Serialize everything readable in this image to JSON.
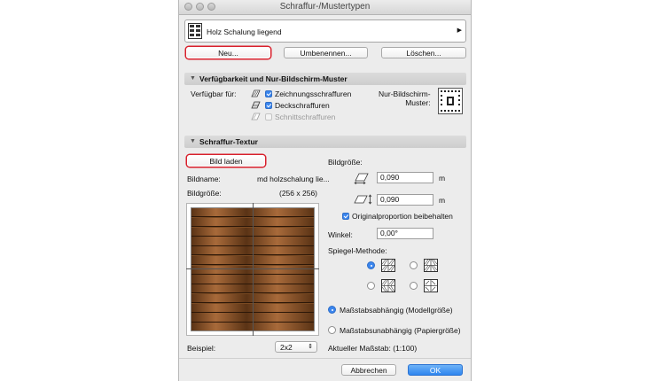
{
  "window": {
    "title": "Schraffur-/Mustertypen"
  },
  "pattern_select": {
    "value": "Holz Schalung liegend",
    "icon": "wood-pattern-icon"
  },
  "top_buttons": {
    "new": "Neu...",
    "rename": "Umbenennen...",
    "delete": "Löschen..."
  },
  "availability": {
    "header": "Verfügbarkeit und Nur-Bildschirm-Muster",
    "available_for": "Verfügbar für:",
    "options": [
      {
        "label": "Zeichnungsschraffuren",
        "checked": true,
        "enabled": true
      },
      {
        "label": "Deckschraffuren",
        "checked": true,
        "enabled": true
      },
      {
        "label": "Schnittschraffuren",
        "checked": false,
        "enabled": false
      }
    ],
    "screen_only_line1": "Nur-Bildschirm-",
    "screen_only_line2": "Muster:"
  },
  "texture": {
    "header": "Schraffur-Textur",
    "load_button": "Bild laden",
    "name_label": "Bildname:",
    "name_value": "md holzschalung lie...",
    "size_label": "Bildgröße:",
    "size_value": "(256 x 256)",
    "example_label": "Beispiel:",
    "example_value": "2x2",
    "colors": {
      "wood_dark": "#5a3315",
      "wood_light": "#a86a3a"
    }
  },
  "image_size": {
    "label": "Bildgröße:",
    "width": "0,090",
    "height": "0,090",
    "unit": "m",
    "keep_ratio_label": "Originalproportion beibehalten",
    "keep_ratio": true
  },
  "angle": {
    "label": "Winkel:",
    "value": "0,00°"
  },
  "mirror": {
    "label": "Spiegel-Methode:",
    "selected_index": 0
  },
  "scale": {
    "model_label": "Maßstabsabhängig (Modellgröße)",
    "paper_label": "Maßstabsunabhängig (Papiergröße)",
    "selected": "model",
    "current_label": "Aktueller Maßstab:",
    "current_value": "(1:100)"
  },
  "footer": {
    "cancel": "Abbrechen",
    "ok": "OK"
  },
  "colors": {
    "accent": "#3b86ee",
    "highlight_border": "#d8202c"
  }
}
